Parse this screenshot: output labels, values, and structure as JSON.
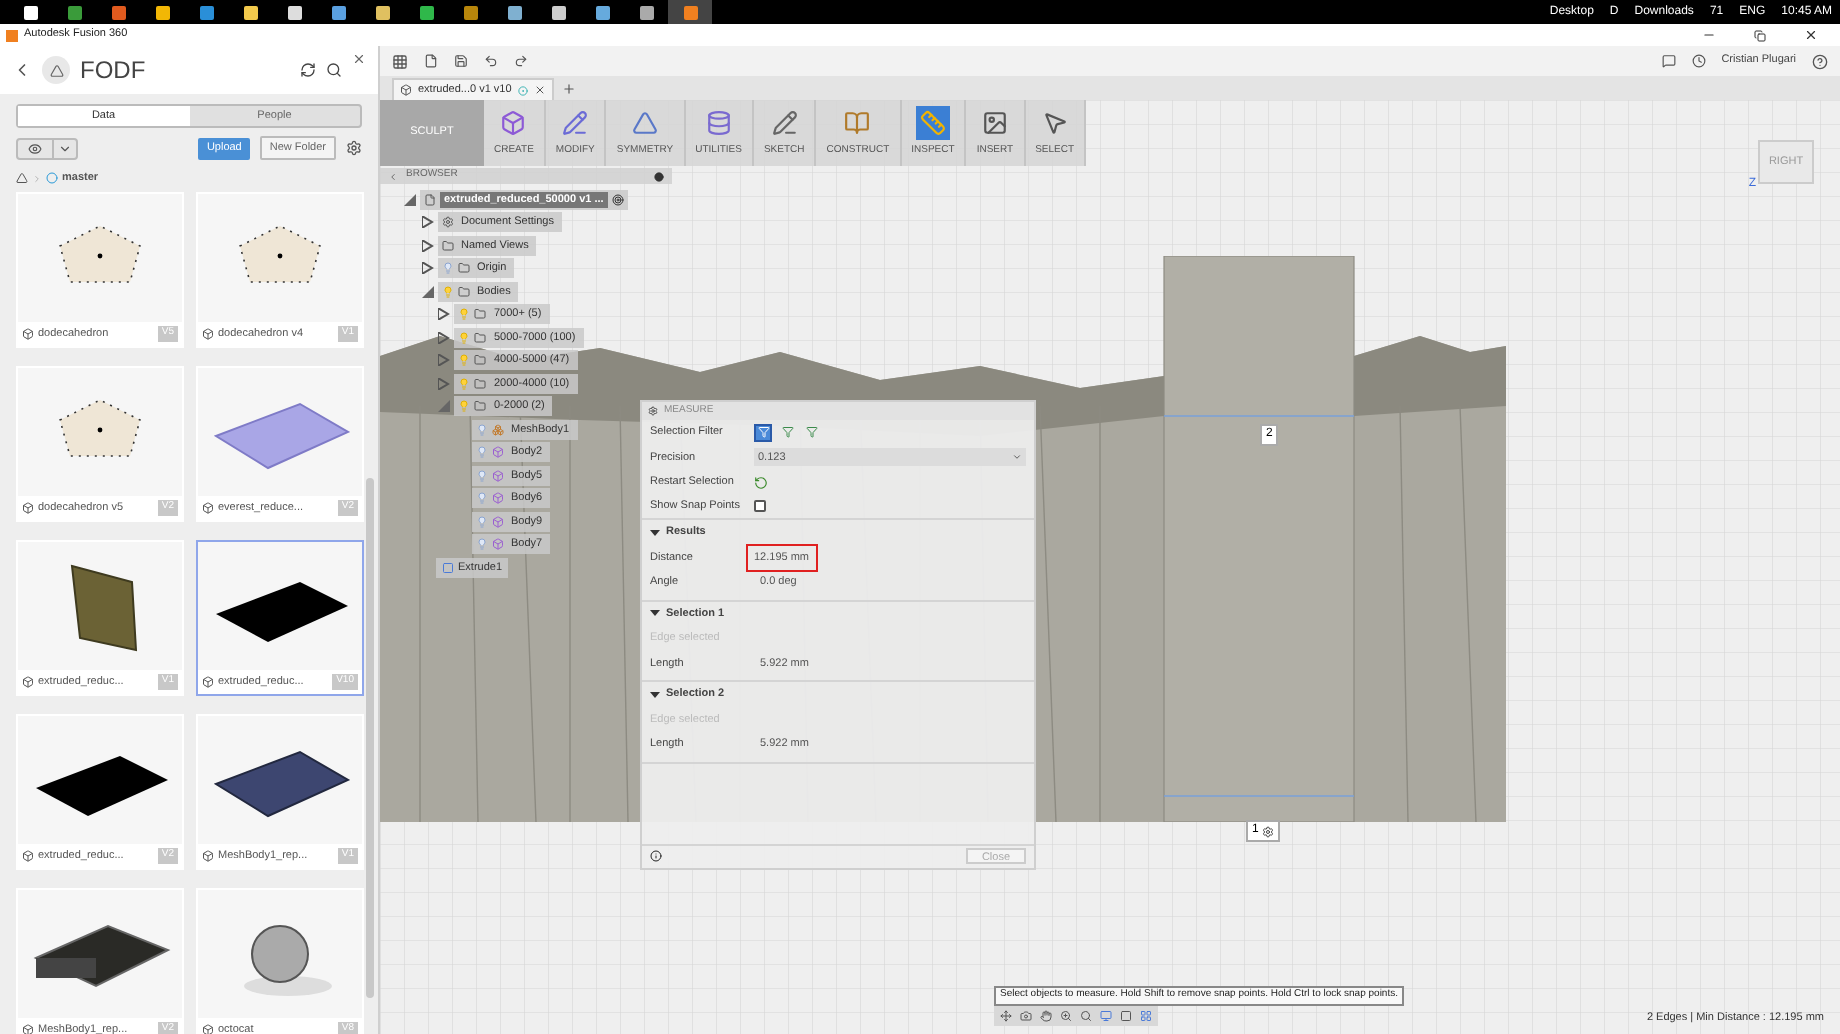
{
  "taskbar": {
    "apps": [
      {
        "selected": false
      },
      {
        "selected": false
      },
      {
        "selected": false
      },
      {
        "selected": false
      },
      {
        "selected": false
      },
      {
        "selected": false
      },
      {
        "selected": false
      },
      {
        "selected": false
      },
      {
        "selected": false
      },
      {
        "selected": false
      },
      {
        "selected": false
      },
      {
        "selected": false
      },
      {
        "selected": false
      },
      {
        "selected": false
      },
      {
        "selected": false
      },
      {
        "selected": true
      }
    ],
    "tray": {
      "desktop": "Desktop",
      "drive": "D",
      "downloads": "Downloads",
      "temperature": "71",
      "language": "ENG",
      "time": "10:45 AM"
    }
  },
  "window": {
    "title": "Autodesk Fusion 360"
  },
  "data_panel": {
    "project": "FODF",
    "tabs": [
      {
        "label": "Data",
        "selected": true
      },
      {
        "label": "People",
        "selected": false
      }
    ],
    "upload": "Upload",
    "new_folder": "New Folder",
    "breadcrumb": "master",
    "files": [
      {
        "name": "dodecahedron",
        "version": "V5",
        "kind": "pentagon",
        "selected": false
      },
      {
        "name": "dodecahedron v4",
        "version": "V1",
        "kind": "pentagon",
        "selected": false
      },
      {
        "name": "dodecahedron v5",
        "version": "V2",
        "kind": "pentagon",
        "selected": false
      },
      {
        "name": "everest_reduce...",
        "version": "V2",
        "kind": "terrain",
        "selected": false
      },
      {
        "name": "extruded_reduc...",
        "version": "V1",
        "kind": "wall",
        "selected": false
      },
      {
        "name": "extruded_reduc...",
        "version": "V10",
        "kind": "slab",
        "selected": true
      },
      {
        "name": "extruded_reduc...",
        "version": "V2",
        "kind": "slab",
        "selected": false
      },
      {
        "name": "MeshBody1_rep...",
        "version": "V1",
        "kind": "mesh",
        "selected": false
      },
      {
        "name": "MeshBody1_rep...",
        "version": "V2",
        "kind": "tray",
        "selected": false
      },
      {
        "name": "octocat",
        "version": "V8",
        "kind": "sphere",
        "selected": false
      }
    ]
  },
  "top_bar": {
    "user": "Cristian Plugari"
  },
  "document_tab": {
    "title": "extruded...0 v1 v10"
  },
  "toolbar": {
    "workspace": "SCULPT",
    "tools": [
      {
        "label": "CREATE",
        "selected": false
      },
      {
        "label": "MODIFY",
        "selected": false
      },
      {
        "label": "SYMMETRY",
        "selected": false
      },
      {
        "label": "UTILITIES",
        "selected": false
      },
      {
        "label": "SKETCH",
        "selected": false
      },
      {
        "label": "CONSTRUCT",
        "selected": false
      },
      {
        "label": "INSPECT",
        "selected": true
      },
      {
        "label": "INSERT",
        "selected": false
      },
      {
        "label": "SELECT",
        "selected": false
      }
    ]
  },
  "browser": {
    "title": "BROWSER",
    "tree": [
      {
        "label": "extruded_reduced_50000 v1 ...",
        "kind": "document",
        "expanded": true,
        "children": [
          {
            "label": "Document Settings",
            "kind": "settings",
            "expanded": false
          },
          {
            "label": "Named Views",
            "kind": "views",
            "expanded": false
          },
          {
            "label": "Origin",
            "kind": "folder",
            "visible": false,
            "expanded": false
          },
          {
            "label": "Bodies",
            "kind": "folder",
            "visible": true,
            "expanded": true,
            "children": [
              {
                "label": "7000+ (5)",
                "kind": "folder",
                "visible": true,
                "expanded": false
              },
              {
                "label": "5000-7000 (100)",
                "kind": "folder",
                "visible": true,
                "expanded": false
              },
              {
                "label": "4000-5000 (47)",
                "kind": "folder",
                "visible": true,
                "expanded": false
              },
              {
                "label": "2000-4000 (10)",
                "kind": "folder",
                "visible": true,
                "expanded": false
              },
              {
                "label": "0-2000 (2)",
                "kind": "folder",
                "visible": true,
                "expanded": true,
                "children": [
                  {
                    "label": "MeshBody1",
                    "kind": "mesh",
                    "visible": false
                  },
                  {
                    "label": "Body2",
                    "kind": "body",
                    "visible": false
                  },
                  {
                    "label": "Body5",
                    "kind": "body",
                    "visible": false
                  },
                  {
                    "label": "Body6",
                    "kind": "body",
                    "visible": false
                  },
                  {
                    "label": "Body9",
                    "kind": "body",
                    "visible": false
                  },
                  {
                    "label": "Body7",
                    "kind": "body",
                    "visible": false
                  }
                ]
              }
            ]
          }
        ]
      }
    ],
    "timeline_item": "Extrude1"
  },
  "measure": {
    "title": "MEASURE",
    "selection_filter": {
      "label": "Selection Filter",
      "filters": [
        {
          "selected": true
        },
        {
          "selected": false
        },
        {
          "selected": false
        }
      ]
    },
    "precision": {
      "label": "Precision",
      "value": "0.123"
    },
    "restart_selection": {
      "label": "Restart Selection"
    },
    "show_snap_points": {
      "label": "Show Snap Points",
      "checked": false
    },
    "sections": [
      {
        "title": "Results",
        "expanded": true,
        "rows": [
          {
            "label": "Distance",
            "value": "12.195 mm",
            "highlighted": true
          },
          {
            "label": "Angle",
            "value": "0.0 deg",
            "highlighted": false
          }
        ]
      },
      {
        "title": "Selection 1",
        "expanded": true,
        "note": "Edge selected",
        "rows": [
          {
            "label": "Length",
            "value": "5.922 mm",
            "highlighted": false
          }
        ]
      },
      {
        "title": "Selection 2",
        "expanded": true,
        "note": "Edge selected",
        "rows": [
          {
            "label": "Length",
            "value": "5.922 mm",
            "highlighted": false
          }
        ]
      }
    ],
    "close": {
      "label": "Close",
      "disabled": true
    }
  },
  "viewport": {
    "view_cube": "RIGHT",
    "axis": "Z",
    "edge_labels": [
      "2",
      "1"
    ],
    "hint": "Select objects to measure. Hold Shift to remove snap points. Hold Ctrl to lock snap points.",
    "status": "2 Edges | Min Distance : 12.195 mm"
  }
}
